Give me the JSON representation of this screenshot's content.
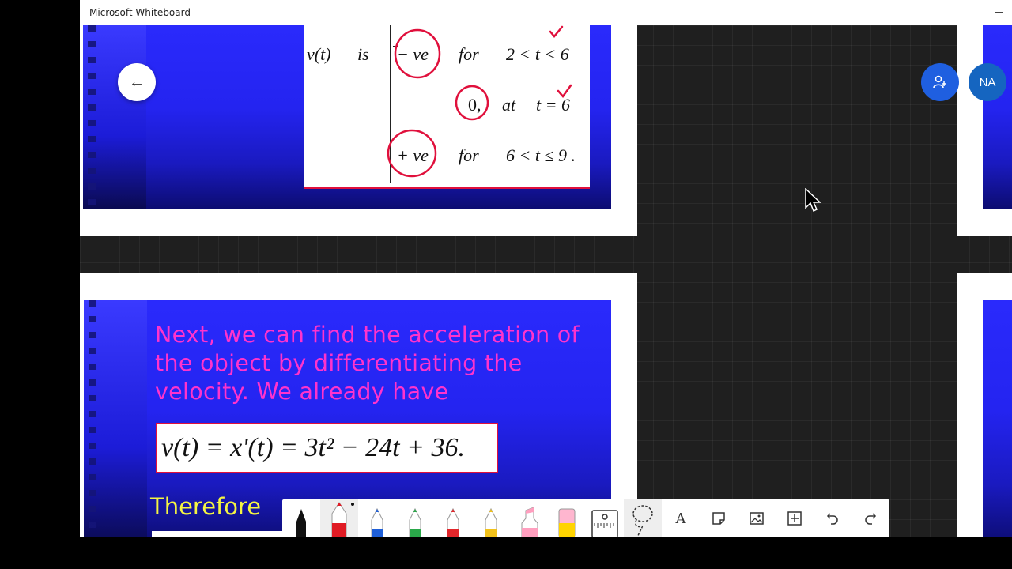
{
  "app": {
    "title": "Microsoft Whiteboard"
  },
  "slide_top": {
    "row1": {
      "lhs": "v(t)",
      "is": "is",
      "value": "− ve",
      "cond_word": "for",
      "cond": "2 < t < 6"
    },
    "row2": {
      "value": "0,",
      "cond_word": "at",
      "cond": "t = 6"
    },
    "row3": {
      "value": "+ ve",
      "cond_word": "for",
      "cond": "6 < t ≤ 9 ."
    }
  },
  "slide_bottom": {
    "paragraph": "Next, we can find the acceleration of the object by differentiating the velocity. We already have",
    "equation": "v(t) = x'(t) = 3t² − 24t + 36.",
    "therefore": "Therefore"
  },
  "back_button": {
    "label": "←"
  },
  "invite_button": {
    "label": "Invite"
  },
  "avatar": {
    "initials": "NA",
    "color": "#1565c0"
  },
  "colors": {
    "accent": "#1f5fe0",
    "ink_red": "#e0103c",
    "slide_text": "#ff33cc",
    "slide_yellow": "#f5f542"
  },
  "toolbar": {
    "tools": [
      {
        "name": "pen-black",
        "color": "#111111"
      },
      {
        "name": "pen-red",
        "color": "#e01b24",
        "selected": true
      },
      {
        "name": "pen-blue",
        "color": "#1e5fd8"
      },
      {
        "name": "pen-green",
        "color": "#2aa84a"
      },
      {
        "name": "pen-red-2",
        "color": "#e2262b"
      },
      {
        "name": "pen-yellow",
        "color": "#f2c21b"
      },
      {
        "name": "highlighter-pink",
        "color": "#ff9fbf"
      },
      {
        "name": "highlighter-yellow",
        "color": "#ffd400"
      },
      {
        "name": "ruler",
        "color": "#444444"
      },
      {
        "name": "lasso",
        "color": "#444444"
      }
    ],
    "text_label": "A"
  }
}
